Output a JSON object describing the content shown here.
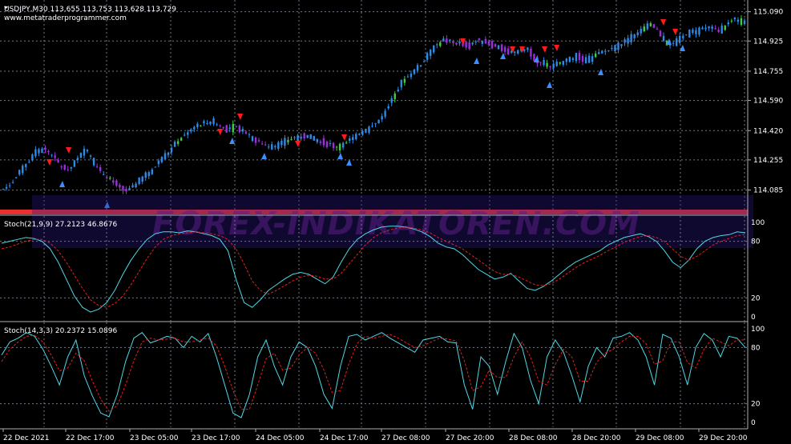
{
  "header": {
    "symbol_line": "USDJPY,M30  113.655 113.753 113.628 113.729",
    "website": "www.metatraderprogrammer.com"
  },
  "watermark": "FOREX-INDIKATOREN.COM",
  "price_axis": [
    "115.090",
    "114.925",
    "114.755",
    "114.590",
    "114.420",
    "114.255",
    "114.085"
  ],
  "stoch1": {
    "label": "Stoch(21,9,9) 27.2123 46.8676",
    "levels": [
      "100",
      "80",
      "20",
      "0"
    ]
  },
  "stoch2": {
    "label": "Stoch(14,3,3) 20.2372 15.0896",
    "levels": [
      "100",
      "80",
      "20",
      "0"
    ]
  },
  "time_axis": [
    "22 Dec 2021",
    "22 Dec 17:00",
    "23 Dec 05:00",
    "23 Dec 17:00",
    "24 Dec 05:00",
    "24 Dec 17:00",
    "27 Dec 08:00",
    "27 Dec 20:00",
    "28 Dec 08:00",
    "28 Dec 20:00",
    "29 Dec 08:00",
    "29 Dec 20:00"
  ],
  "colors": {
    "background": "#000000",
    "grid": "#6f7a86",
    "bull_candle": "#2e8ae6",
    "bull_candle_alt": "#3ecf3e",
    "bear_candle": "#9b2fe0",
    "main_line": "#4fd7e6",
    "signal_line": "#e02020",
    "arrow_up": "#3b8fff",
    "arrow_down": "#ff1a1a"
  },
  "chart_data": [
    {
      "type": "line",
      "title": "USDJPY,M30",
      "ylim": [
        114.02,
        115.12
      ],
      "y": [
        114.09,
        114.12,
        114.18,
        114.24,
        114.3,
        114.32,
        114.28,
        114.22,
        114.2,
        114.26,
        114.32,
        114.24,
        114.18,
        114.14,
        114.1,
        114.08,
        114.12,
        114.16,
        114.2,
        114.26,
        114.3,
        114.36,
        114.4,
        114.44,
        114.46,
        114.47,
        114.45,
        114.43,
        114.44,
        114.42,
        114.38,
        114.35,
        114.33,
        114.34,
        114.36,
        114.38,
        114.39,
        114.38,
        114.36,
        114.35,
        114.33,
        114.34,
        114.38,
        114.41,
        114.43,
        114.47,
        114.52,
        114.62,
        114.7,
        114.74,
        114.78,
        114.84,
        114.9,
        114.93,
        114.92,
        114.91,
        114.9,
        114.93,
        114.92,
        114.9,
        114.88,
        114.86,
        114.87,
        114.88,
        114.82,
        114.8,
        114.78,
        114.8,
        114.82,
        114.84,
        114.81,
        114.84,
        114.86,
        114.88,
        114.9,
        114.93,
        114.96,
        115.0,
        115.02,
        114.96,
        114.9,
        114.92,
        114.96,
        114.98,
        114.99,
        115.0,
        114.98,
        115.02,
        115.05,
        115.03
      ]
    },
    {
      "type": "line",
      "title": "Stoch(21,9,9) 27.2123 46.8676",
      "ylim": [
        0,
        100
      ],
      "series": [
        {
          "name": "main",
          "values": [
            78,
            80,
            82,
            84,
            83,
            80,
            72,
            58,
            40,
            22,
            10,
            5,
            8,
            15,
            28,
            45,
            60,
            72,
            82,
            88,
            90,
            90,
            89,
            91,
            90,
            88,
            86,
            82,
            70,
            40,
            15,
            10,
            18,
            28,
            34,
            40,
            45,
            47,
            45,
            40,
            35,
            42,
            58,
            72,
            82,
            88,
            92,
            95,
            96,
            96,
            95,
            93,
            90,
            85,
            78,
            74,
            72,
            66,
            58,
            50,
            45,
            40,
            42,
            46,
            38,
            30,
            28,
            32,
            38,
            45,
            52,
            58,
            62,
            66,
            70,
            76,
            80,
            84,
            86,
            88,
            85,
            80,
            70,
            58,
            52,
            60,
            72,
            80,
            84,
            86,
            87,
            90,
            89
          ]
        },
        {
          "name": "signal",
          "values": [
            72,
            74,
            77,
            80,
            82,
            82,
            78,
            70,
            58,
            44,
            30,
            18,
            12,
            10,
            14,
            22,
            34,
            48,
            62,
            74,
            82,
            86,
            88,
            89,
            90,
            89,
            88,
            86,
            82,
            72,
            56,
            38,
            28,
            24,
            28,
            33,
            38,
            42,
            44,
            43,
            40,
            40,
            46,
            56,
            66,
            76,
            84,
            89,
            92,
            94,
            95,
            94,
            92,
            89,
            84,
            80,
            76,
            72,
            66,
            60,
            54,
            48,
            45,
            45,
            42,
            38,
            34,
            33,
            35,
            40,
            46,
            52,
            57,
            61,
            65,
            70,
            74,
            79,
            82,
            85,
            86,
            84,
            80,
            72,
            64,
            60,
            64,
            70,
            76,
            80,
            83,
            86,
            87
          ]
        }
      ]
    },
    {
      "type": "line",
      "title": "Stoch(14,3,3) 20.2372 15.0896",
      "ylim": [
        0,
        100
      ],
      "series": [
        {
          "name": "main",
          "values": [
            72,
            86,
            90,
            96,
            92,
            78,
            60,
            40,
            70,
            88,
            50,
            28,
            10,
            6,
            30,
            65,
            90,
            96,
            85,
            88,
            92,
            90,
            80,
            92,
            86,
            95,
            70,
            40,
            10,
            5,
            30,
            70,
            88,
            60,
            40,
            70,
            86,
            80,
            60,
            30,
            15,
            60,
            92,
            94,
            88,
            92,
            96,
            90,
            85,
            80,
            75,
            88,
            90,
            92,
            86,
            85,
            40,
            14,
            70,
            60,
            30,
            65,
            95,
            80,
            45,
            20,
            70,
            88,
            75,
            50,
            22,
            60,
            80,
            70,
            90,
            92,
            96,
            88,
            70,
            40,
            94,
            90,
            70,
            40,
            80,
            95,
            88,
            70,
            92,
            90,
            80
          ]
        },
        {
          "name": "signal",
          "values": [
            65,
            78,
            86,
            92,
            93,
            86,
            72,
            55,
            58,
            74,
            66,
            44,
            25,
            12,
            18,
            40,
            66,
            86,
            90,
            88,
            89,
            90,
            86,
            86,
            88,
            90,
            82,
            60,
            34,
            14,
            14,
            40,
            68,
            74,
            56,
            58,
            72,
            80,
            74,
            56,
            32,
            34,
            62,
            84,
            92,
            90,
            92,
            94,
            90,
            85,
            80,
            82,
            86,
            90,
            89,
            87,
            66,
            34,
            38,
            56,
            48,
            48,
            70,
            86,
            70,
            44,
            40,
            62,
            78,
            70,
            44,
            44,
            64,
            74,
            78,
            86,
            92,
            92,
            84,
            62,
            66,
            86,
            86,
            64,
            58,
            78,
            90,
            86,
            82,
            88,
            88
          ]
        }
      ]
    }
  ]
}
